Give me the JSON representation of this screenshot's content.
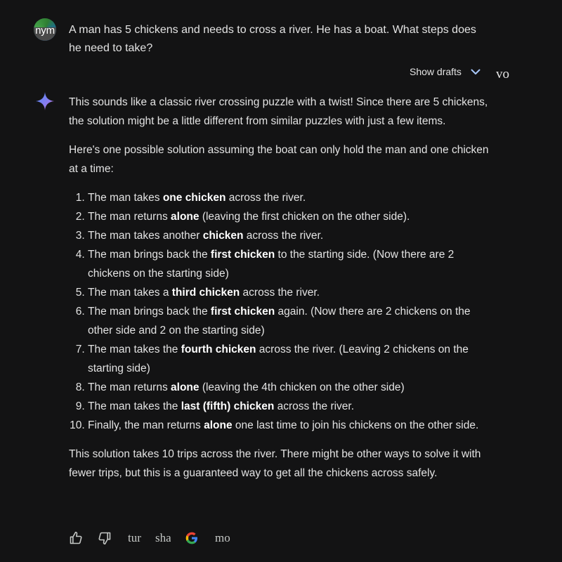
{
  "user": {
    "avatar_text": "nym",
    "message": "A man has 5 chickens and needs to cross a river. He has a boat. What steps does he need to take?"
  },
  "drafts": {
    "label": "Show drafts",
    "icon": "chevron-down-icon",
    "voice_label": "vo"
  },
  "response": {
    "icon": "gemini-spark-icon",
    "intro": "This sounds like a classic river crossing puzzle with a twist!  Since there are 5 chickens, the solution might be a little different from similar puzzles with just a few items.",
    "lead": "Here's one possible solution assuming the boat can only hold the man and one chicken at a time:",
    "steps": [
      {
        "pre": "The man takes ",
        "bold": "one chicken",
        "post": " across the river."
      },
      {
        "pre": "The man returns ",
        "bold": "alone",
        "post": " (leaving the first chicken on the other side)."
      },
      {
        "pre": "The man takes another ",
        "bold": "chicken",
        "post": " across the river."
      },
      {
        "pre": "The man brings back the ",
        "bold": "first chicken",
        "post": " to the starting side. (Now there are 2 chickens on the starting side)"
      },
      {
        "pre": "The man takes a ",
        "bold": "third chicken",
        "post": " across the river."
      },
      {
        "pre": "The man brings back the ",
        "bold": "first chicken",
        "post": " again. (Now there are 2 chickens on the other side and 2 on the starting side)"
      },
      {
        "pre": "The man takes the ",
        "bold": "fourth chicken",
        "post": " across the river. (Leaving 2 chickens on the starting side)"
      },
      {
        "pre": "The man returns ",
        "bold": "alone",
        "post": " (leaving the 4th chicken on the other side)"
      },
      {
        "pre": "The man takes the ",
        "bold": "last (fifth) chicken",
        "post": " across the river."
      },
      {
        "pre": "Finally, the man returns ",
        "bold": "alone",
        "post": " one last time to join his chickens on the other side."
      }
    ],
    "conclusion": "This solution takes 10 trips across the river.  There might be other ways to solve it with fewer trips, but this is a guaranteed way to get all the chickens across safely."
  },
  "actions": {
    "thumbs_up_icon": "thumbs-up-icon",
    "thumbs_down_icon": "thumbs-down-icon",
    "tune_label": "tur",
    "share_label": "sha",
    "google_icon": "google-g-icon",
    "more_label": "mo"
  }
}
